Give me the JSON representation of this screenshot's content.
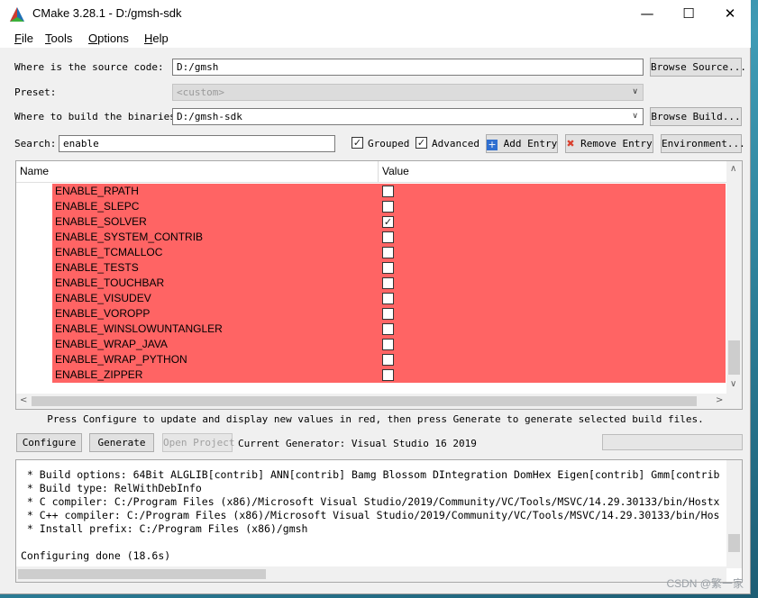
{
  "window": {
    "title": "CMake 3.28.1 - D:/gmsh-sdk"
  },
  "menu": [
    {
      "u": "F",
      "rest": "ile"
    },
    {
      "u": "T",
      "rest": "ools"
    },
    {
      "u": "O",
      "rest": "ptions"
    },
    {
      "u": "H",
      "rest": "elp"
    }
  ],
  "form": {
    "source_label": "Where is the source code:",
    "source_value": "D:/gmsh",
    "browse_source": "Browse Source...",
    "preset_label": "Preset:",
    "preset_value": "<custom>",
    "build_label": "Where to build the binaries:",
    "build_value": "D:/gmsh-sdk",
    "browse_build": "Browse Build...",
    "search_label": "Search:",
    "search_value": "enable",
    "grouped_label": "Grouped",
    "grouped_checked": true,
    "advanced_label": "Advanced",
    "advanced_checked": true,
    "add_entry": "Add Entry",
    "remove_entry": "Remove Entry",
    "environment": "Environment..."
  },
  "table": {
    "col_name": "Name",
    "col_value": "Value",
    "rows": [
      {
        "name": "ENABLE_RPATH",
        "checked": false
      },
      {
        "name": "ENABLE_SLEPC",
        "checked": false
      },
      {
        "name": "ENABLE_SOLVER",
        "checked": true
      },
      {
        "name": "ENABLE_SYSTEM_CONTRIB",
        "checked": false
      },
      {
        "name": "ENABLE_TCMALLOC",
        "checked": false
      },
      {
        "name": "ENABLE_TESTS",
        "checked": false
      },
      {
        "name": "ENABLE_TOUCHBAR",
        "checked": false
      },
      {
        "name": "ENABLE_VISUDEV",
        "checked": false
      },
      {
        "name": "ENABLE_VOROPP",
        "checked": false
      },
      {
        "name": "ENABLE_WINSLOWUNTANGLER",
        "checked": false
      },
      {
        "name": "ENABLE_WRAP_JAVA",
        "checked": false
      },
      {
        "name": "ENABLE_WRAP_PYTHON",
        "checked": false
      },
      {
        "name": "ENABLE_ZIPPER",
        "checked": false
      }
    ],
    "highlight_color": "#ff6464"
  },
  "hint": "Press Configure to update and display new values in red, then press Generate to generate selected build files.",
  "actions": {
    "configure": "Configure",
    "generate": "Generate",
    "open_project": "Open Project",
    "generator_label": "Current Generator: Visual Studio 16 2019"
  },
  "output": [
    " * Build options: 64Bit ALGLIB[contrib] ANN[contrib] Bamg Blossom DIntegration DomHex Eigen[contrib] Gmm[contrib",
    " * Build type: RelWithDebInfo",
    " * C compiler: C:/Program Files (x86)/Microsoft Visual Studio/2019/Community/VC/Tools/MSVC/14.29.30133/bin/Hostx",
    " * C++ compiler: C:/Program Files (x86)/Microsoft Visual Studio/2019/Community/VC/Tools/MSVC/14.29.30133/bin/Hos",
    " * Install prefix: C:/Program Files (x86)/gmsh",
    "",
    "Configuring done (18.6s)"
  ],
  "watermark": "CSDN @繁一家"
}
